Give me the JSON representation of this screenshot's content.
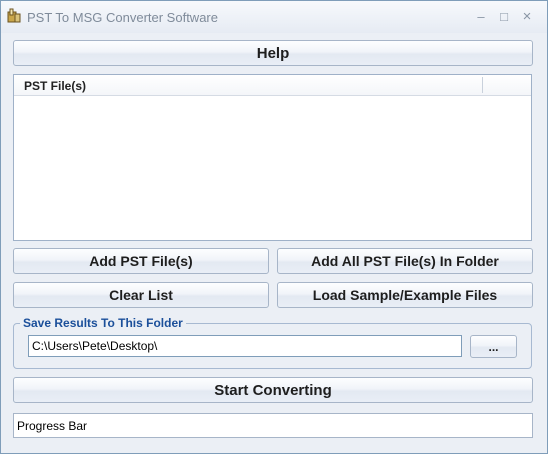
{
  "window": {
    "title": "PST To MSG Converter Software",
    "minimize_glyph": "–",
    "maximize_glyph": "□",
    "close_glyph": "×"
  },
  "buttons": {
    "help": "Help",
    "add_files": "Add PST File(s)",
    "add_folder": "Add All PST File(s) In Folder",
    "clear_list": "Clear List",
    "load_sample": "Load Sample/Example Files",
    "browse": "...",
    "start": "Start Converting"
  },
  "file_list": {
    "column_header": "PST File(s)",
    "items": []
  },
  "output": {
    "group_label": "Save Results To This Folder",
    "folder_path": "C:\\Users\\Pete\\Desktop\\"
  },
  "progress": {
    "label": "Progress Bar"
  }
}
